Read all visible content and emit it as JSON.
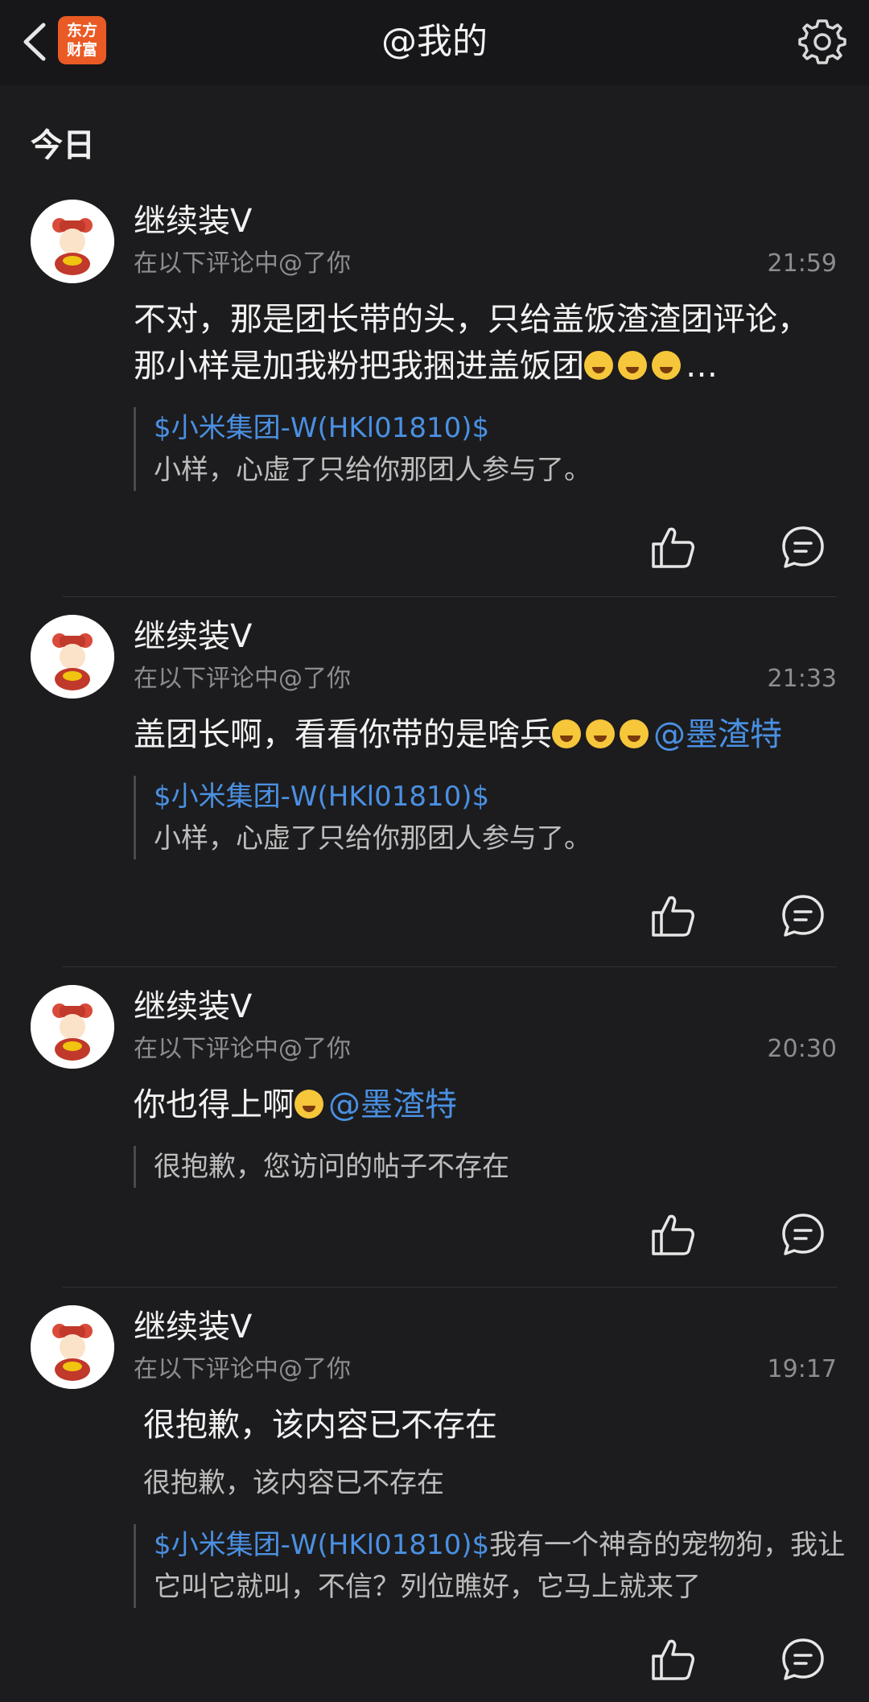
{
  "header": {
    "title": "@我的",
    "logo_line1": "东方",
    "logo_line2": "财富"
  },
  "section_title": "今日",
  "colors": {
    "mention": "#4a90e2",
    "logo": "#ea5a25",
    "background": "#1c1c1e"
  },
  "items": [
    {
      "username": "继续装V",
      "subtitle": "在以下评论中@了你",
      "time": "21:59",
      "content": "不对，那是团长带的头，只给盖饭渣渣团评论，那小样是加我粉把我捆进盖饭团",
      "content_emoji": "😭😭😭",
      "content_tail": "…",
      "quote_stock": "$小米集团-W(HKl01810)$",
      "quote_text": "小样，心虚了只给你那团人参与了。"
    },
    {
      "username": "继续装V",
      "subtitle": "在以下评论中@了你",
      "time": "21:33",
      "content": "盖团长啊，看看你带的是啥兵",
      "content_emoji": "😭😭😭",
      "mention": "@墨渣特",
      "quote_stock": "$小米集团-W(HKl01810)$",
      "quote_text": "小样，心虚了只给你那团人参与了。"
    },
    {
      "username": "继续装V",
      "subtitle": "在以下评论中@了你",
      "time": "20:30",
      "content": "你也得上啊",
      "content_emoji": "😁",
      "mention": "@墨渣特",
      "quote_text": "很抱歉，您访问的帖子不存在"
    },
    {
      "username": "继续装V",
      "subtitle": "在以下评论中@了你",
      "time": "19:17",
      "content": "很抱歉，该内容已不存在",
      "content2": "很抱歉，该内容已不存在",
      "quote_stock": "$小米集团-W(HKl01810)$",
      "quote_text": "我有一个神奇的宠物狗，我让它叫它就叫，不信？列位瞧好，它马上就来了"
    }
  ],
  "icons": {
    "back": "chevron-left-icon",
    "settings": "gear-icon",
    "like": "thumbs-up-icon",
    "reply": "comment-bubble-icon"
  }
}
